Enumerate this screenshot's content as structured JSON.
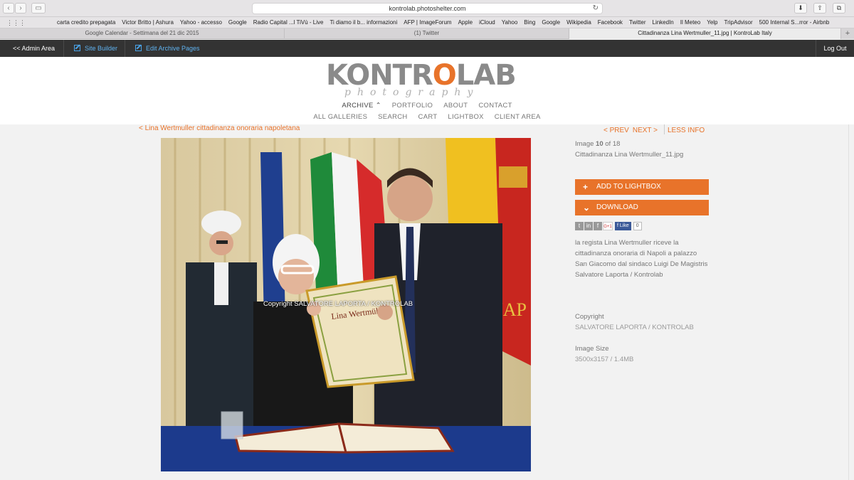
{
  "browser": {
    "url": "kontrolab.photoshelter.com",
    "bookmarks": [
      "carta credito prepagata",
      "Victor Britto | Ashura",
      "Yahoo - accesso",
      "Google",
      "Radio Capital ...l TiVù - Live",
      "Ti diamo il b... informazioni",
      "AFP | ImageForum",
      "Apple",
      "iCloud",
      "Yahoo",
      "Bing",
      "Google",
      "Wikipedia",
      "Facebook",
      "Twitter",
      "LinkedIn",
      "Il Meteo",
      "Yelp",
      "TripAdvisor",
      "500 Internal S...rror - Airbnb"
    ],
    "tabs": [
      {
        "label": "Google Calendar - Settimana del 21 dic 2015",
        "active": false
      },
      {
        "label": "(1) Twitter",
        "active": false
      },
      {
        "label": "Cittadinanza Lina Wertmuller_11.jpg | KontroLab Italy",
        "active": true
      }
    ]
  },
  "admin": {
    "admin_area": "<< Admin Area",
    "site_builder": "Site Builder",
    "edit_archive": "Edit Archive Pages",
    "logout": "Log Out"
  },
  "header": {
    "logo_main_a": "KONTR",
    "logo_main_b": "O",
    "logo_main_c": "LAB",
    "logo_sub": "photography",
    "nav_primary": [
      "ARCHIVE ⌃",
      "PORTFOLIO",
      "ABOUT",
      "CONTACT"
    ],
    "nav_secondary": [
      "ALL GALLERIES",
      "SEARCH",
      "CART",
      "LIGHTBOX",
      "CLIENT AREA"
    ]
  },
  "gallery": {
    "back_link": "< Lina Wertmuller cittadinanza onoraria napoletana",
    "prev": "< PREV",
    "next": "NEXT >",
    "less_info": "LESS INFO"
  },
  "photo": {
    "watermark": "Copyright SALVATORE LAPORTA / KONTROLAB"
  },
  "info": {
    "image_prefix": "Image",
    "image_index": "10",
    "image_of": "of 18",
    "filename": "Cittadinanza Lina Wertmuller_11.jpg",
    "add_lightbox": "ADD TO LIGHTBOX",
    "download": "DOWNLOAD",
    "fb_like": "Like",
    "fb_count": "0",
    "description": "la regista Lina Wertmuller riceve la cittadinanza onoraria di Napoli a palazzo San Giacomo dal sindaco Luigi De Magistris",
    "credit": "Salvatore Laporta / Kontrolab",
    "copyright_label": "Copyright",
    "copyright_value": "SALVATORE LAPORTA / KONTROLAB",
    "size_label": "Image Size",
    "size_value": "3500x3157 / 1.4MB"
  },
  "colors": {
    "accent": "#e8732a",
    "admin_bar": "#333333",
    "admin_link": "#5fb2f0"
  }
}
